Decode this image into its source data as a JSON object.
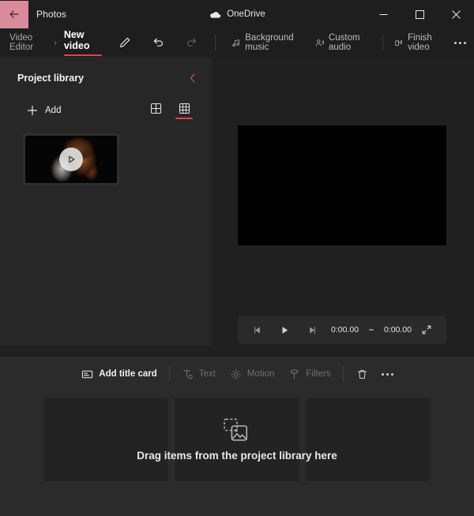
{
  "window": {
    "app_title": "Photos",
    "back_icon": "back-arrow-icon",
    "cloud_label": "OneDrive",
    "cloud_icon": "onedrive-cloud-icon",
    "minimize_label": "—",
    "maximize_label": "☐",
    "close_label": "✕"
  },
  "commandbar": {
    "breadcrumb_root": "Video Editor",
    "breadcrumb_sep": "›",
    "breadcrumb_current": "New video",
    "rename_icon": "pencil-icon",
    "undo_icon": "undo-icon",
    "redo_icon": "redo-icon",
    "items": [
      {
        "label": "Background music",
        "icon": "music-note-icon",
        "enabled": true
      },
      {
        "label": "Custom audio",
        "icon": "person-audio-icon",
        "enabled": true
      },
      {
        "label": "Finish video",
        "icon": "export-video-icon",
        "enabled": true
      }
    ],
    "overflow_icon": "more-horizontal-icon"
  },
  "library": {
    "title": "Project library",
    "collapse_icon": "chevron-left-icon",
    "add_label": "Add",
    "add_icon": "plus-icon",
    "view_large_icon": "grid-2x2-icon",
    "view_small_icon": "grid-3x3-icon",
    "selected_view": "small",
    "media": [
      {
        "name": "video-thumbnail",
        "play_icon": "play-circle-icon"
      }
    ]
  },
  "preview": {
    "player": {
      "prev_frame_icon": "previous-frame-icon",
      "play_icon": "play-icon",
      "next_frame_icon": "next-frame-icon",
      "current_time": "0:00.00",
      "total_time": "0:00.00",
      "fullscreen_icon": "expand-icon"
    }
  },
  "storyboard": {
    "toolbar": [
      {
        "label": "Add title card",
        "icon": "title-card-icon",
        "enabled": true
      },
      {
        "label": "Text",
        "icon": "text-icon",
        "enabled": false
      },
      {
        "label": "Motion",
        "icon": "motion-icon",
        "enabled": false
      },
      {
        "label": "Filters",
        "icon": "filters-icon",
        "enabled": false
      }
    ],
    "delete_icon": "trash-icon",
    "overflow_icon": "more-horizontal-icon",
    "empty_text": "Drag items from the project library here",
    "empty_icon": "media-stack-icon",
    "slot_count": 3
  },
  "colors": {
    "accent_red": "#e0444a",
    "back_button_bg": "#d98a9b",
    "window_bg": "#202020",
    "panel_bg": "#272727",
    "storyboard_bg": "#2b2b2b"
  }
}
